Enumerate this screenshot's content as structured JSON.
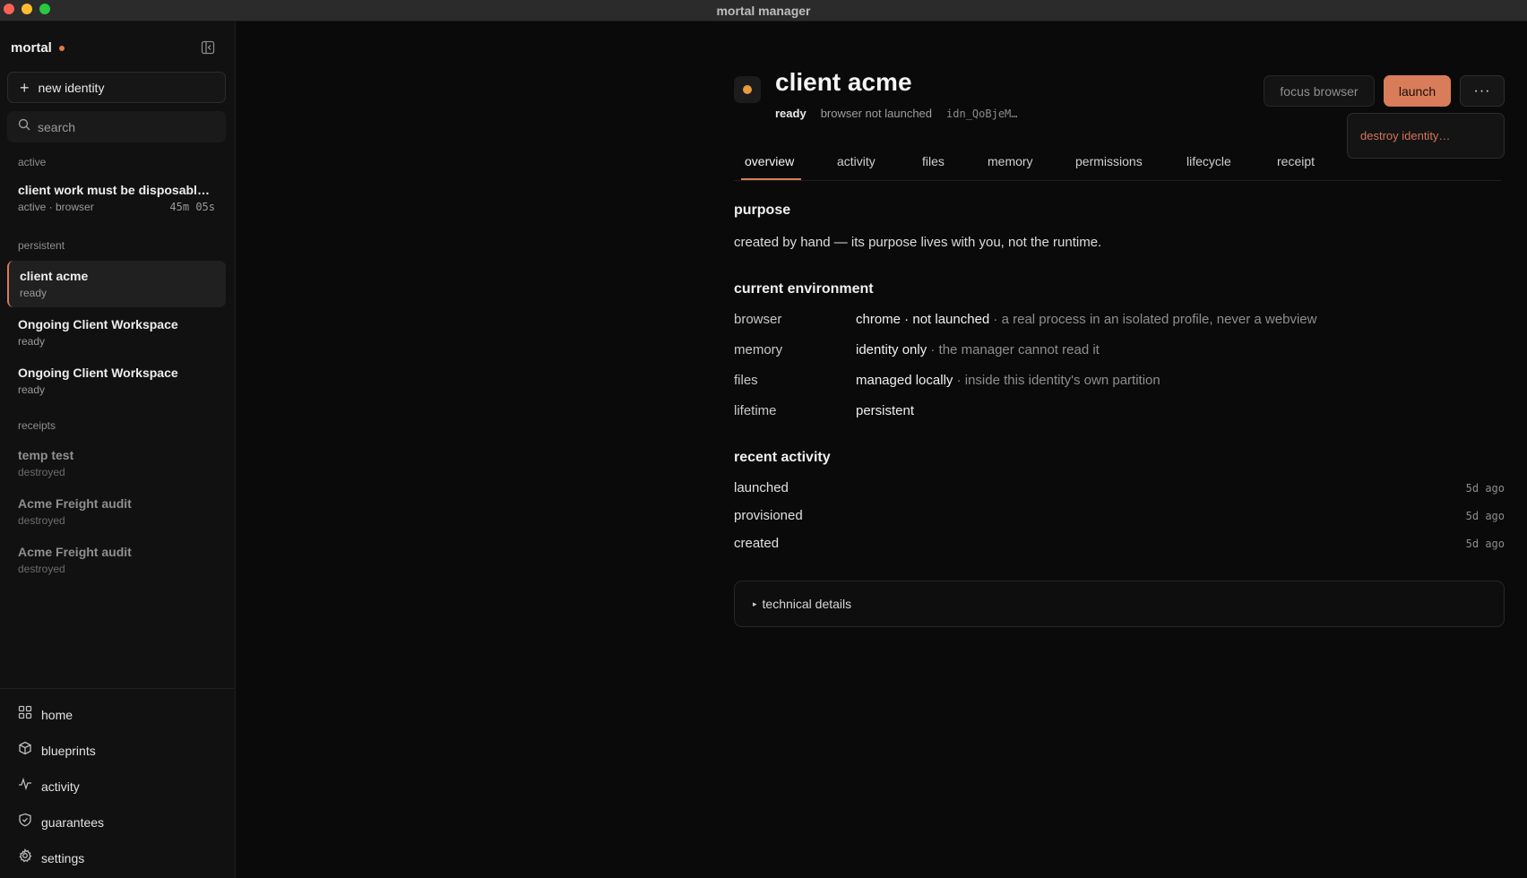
{
  "window": {
    "title": "mortal manager"
  },
  "sidebar": {
    "brand": "mortal",
    "new_identity_label": "new identity",
    "search_placeholder": "search",
    "sections": {
      "active": "active",
      "persistent": "persistent",
      "receipts": "receipts"
    },
    "active_items": [
      {
        "name": "client work must be disposable ...",
        "sub": "active · browser",
        "timer": "45m 05s"
      }
    ],
    "persistent_items": [
      {
        "name": "client acme",
        "sub": "ready"
      },
      {
        "name": "Ongoing Client Workspace",
        "sub": "ready"
      },
      {
        "name": "Ongoing Client Workspace",
        "sub": "ready"
      }
    ],
    "receipt_items": [
      {
        "name": "temp test",
        "sub": "destroyed"
      },
      {
        "name": "Acme Freight audit",
        "sub": "destroyed"
      },
      {
        "name": "Acme Freight audit",
        "sub": "destroyed"
      }
    ],
    "bottom_nav": [
      {
        "label": "home",
        "icon": "grid-icon"
      },
      {
        "label": "blueprints",
        "icon": "cube-icon"
      },
      {
        "label": "activity",
        "icon": "pulse-icon"
      },
      {
        "label": "guarantees",
        "icon": "shield-check-icon"
      },
      {
        "label": "settings",
        "icon": "gear-icon"
      }
    ]
  },
  "identity": {
    "title": "client acme",
    "status": "ready",
    "browser_state": "browser not launched",
    "id": "idn_QoBjeM…",
    "status_color": "#e89b3c"
  },
  "actions": {
    "focus_browser": "focus browser",
    "launch": "launch",
    "more": "···",
    "menu_destroy": "destroy identity…"
  },
  "tabs": [
    "overview",
    "activity",
    "files",
    "memory",
    "permissions",
    "lifecycle",
    "receipt"
  ],
  "overview": {
    "purpose_heading": "purpose",
    "purpose_text": "created by hand — its purpose lives with you, not the runtime.",
    "env_heading": "current environment",
    "env": [
      {
        "key": "browser",
        "value": "chrome · not launched",
        "note": " · a real process in an isolated profile, never a webview"
      },
      {
        "key": "memory",
        "value": "identity only",
        "note": " · the manager cannot read it"
      },
      {
        "key": "files",
        "value": "managed locally",
        "note": " · inside this identity's own partition"
      },
      {
        "key": "lifetime",
        "value": "persistent",
        "note": ""
      }
    ],
    "activity_heading": "recent activity",
    "activity": [
      {
        "label": "launched",
        "when": "5d ago"
      },
      {
        "label": "provisioned",
        "when": "5d ago"
      },
      {
        "label": "created",
        "when": "5d ago"
      }
    ],
    "technical_details": "technical details"
  },
  "colors": {
    "accent": "#d97c54",
    "launch_bg": "#d97c5a",
    "danger_text": "#d2765a"
  }
}
